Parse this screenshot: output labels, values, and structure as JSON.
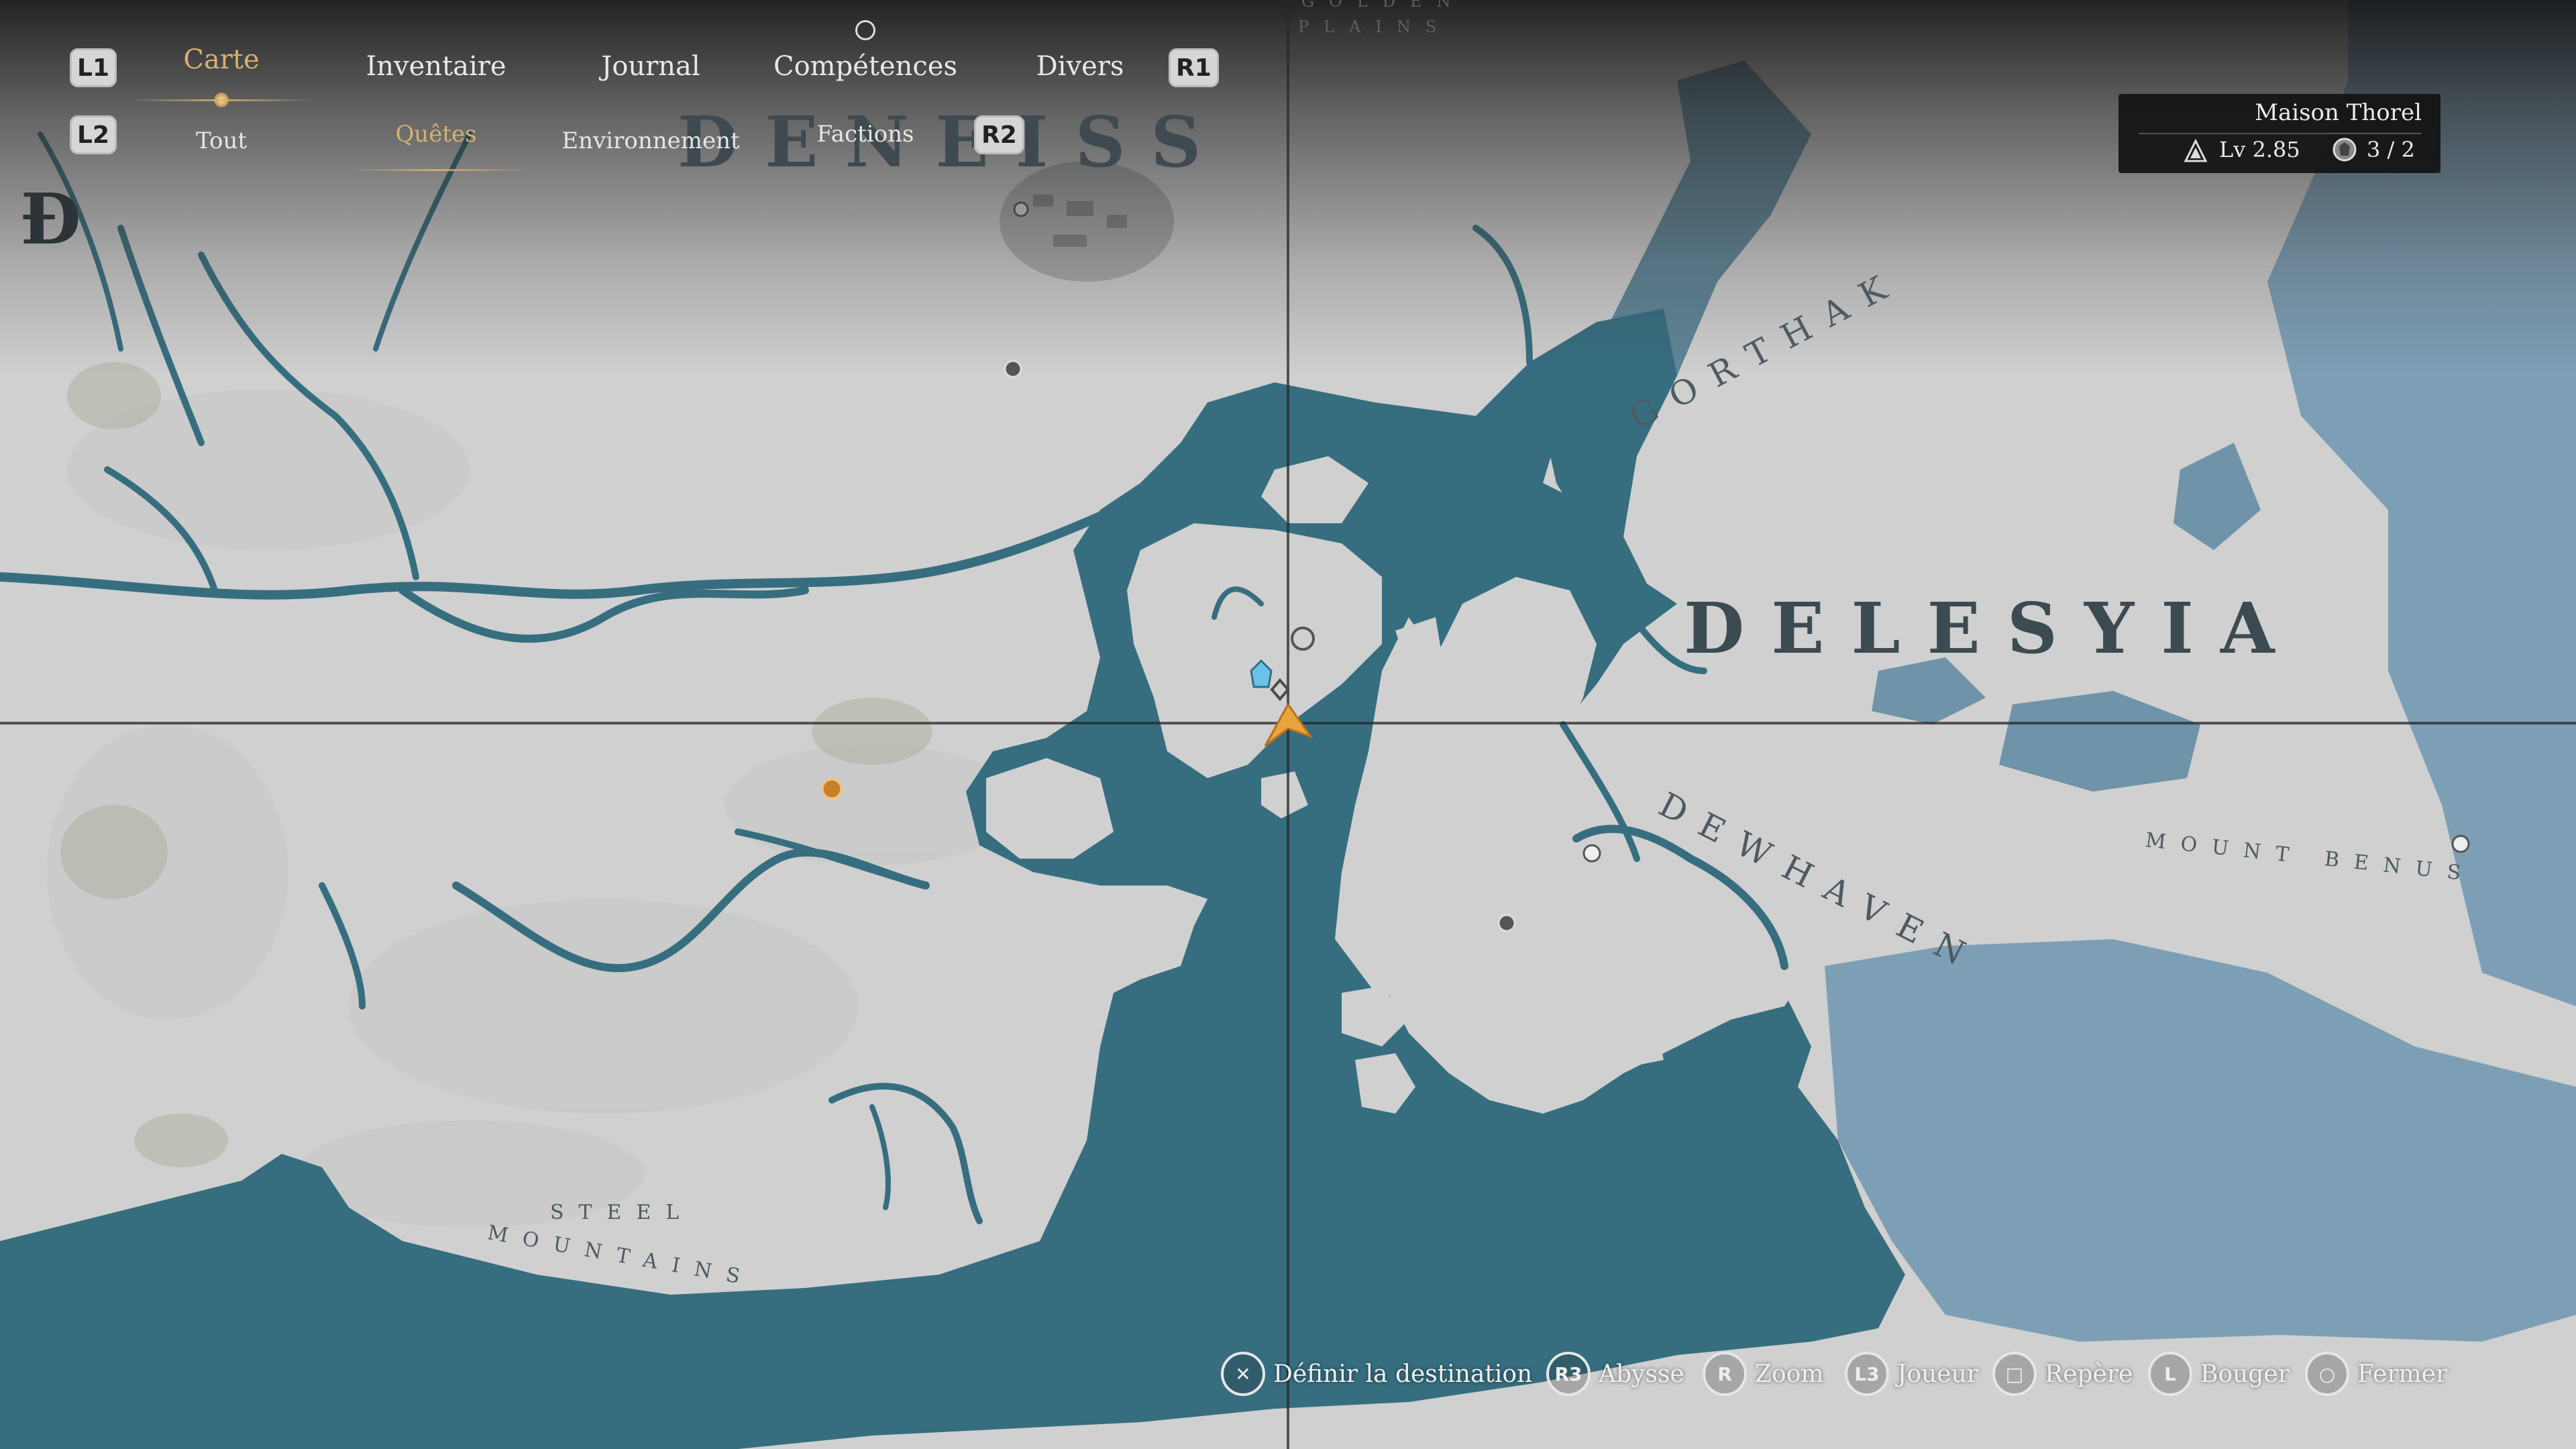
{
  "nav": {
    "l1": "L1",
    "r1": "R1",
    "l2": "L2",
    "r2": "R2",
    "tabs": [
      {
        "label": "Carte",
        "active": true
      },
      {
        "label": "Inventaire",
        "active": false
      },
      {
        "label": "Journal",
        "active": false
      },
      {
        "label": "Compétences",
        "active": false
      },
      {
        "label": "Divers",
        "active": false
      }
    ],
    "subtabs": [
      {
        "label": "Tout",
        "active": false
      },
      {
        "label": "Quêtes",
        "active": true
      },
      {
        "label": "Environnement",
        "active": false
      },
      {
        "label": "Factions",
        "active": false
      }
    ]
  },
  "player": {
    "name": "Maison Thorel",
    "level": "Lv 2.85",
    "count": "3 / 2"
  },
  "map_labels": {
    "deneiss": "DENEISS",
    "delesyia": "DELESYIA",
    "gorthak": "GORTHAK",
    "dewhaven": "DEWHAVEN",
    "steel_mountains_1": "STEEL",
    "steel_mountains_2": "MOUNTAINS",
    "mount_benus": "MOUNT BENUS",
    "golden_plains_1": "GOLDEN",
    "golden_plains_2": "PLAINS",
    "d_fragment": "Đ"
  },
  "prompts": [
    {
      "glyph": "✕",
      "label": "Définir la destination"
    },
    {
      "glyph": "R3",
      "label": "Abysse"
    },
    {
      "glyph": "R",
      "label": "Zoom"
    },
    {
      "glyph": "L3",
      "label": "Joueur"
    },
    {
      "glyph": "□",
      "label": "Repère"
    },
    {
      "glyph": "L",
      "label": "Bouger"
    },
    {
      "glyph": "○",
      "label": "Fermer"
    }
  ],
  "colors": {
    "land": "#cfd0cf",
    "sea": "#366e80",
    "far_sea": "#7d9fb6",
    "accent": "#d9b070",
    "player_marker": "#e9a53a",
    "quest_marker": "#6cc2e6"
  },
  "icons": {
    "level": "rank-icon",
    "count": "crest-icon",
    "player": "player-arrow-icon",
    "quest": "quest-marker-icon"
  }
}
